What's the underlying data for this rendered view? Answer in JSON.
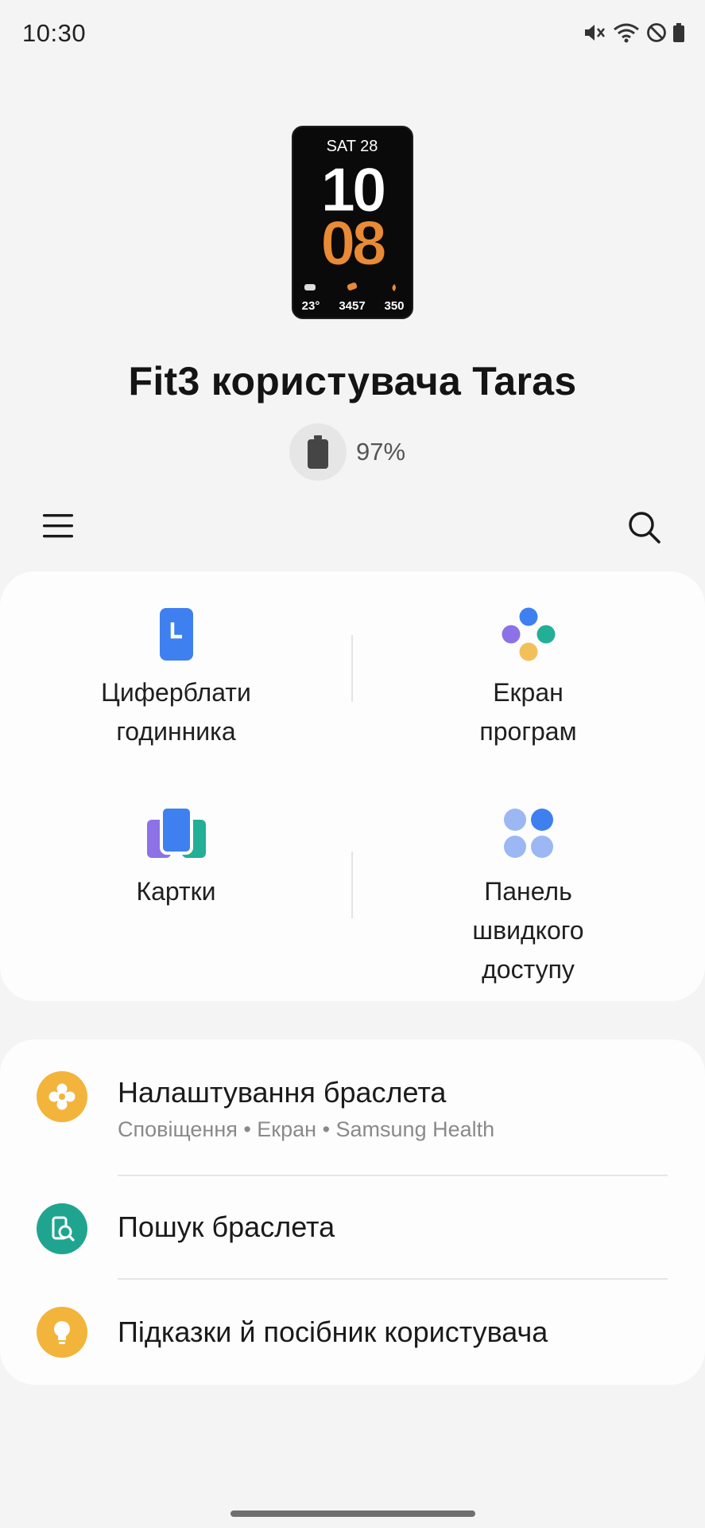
{
  "status_bar": {
    "time": "10:30"
  },
  "watch_face": {
    "date": "SAT 28",
    "hour": "10",
    "minute": "08",
    "temperature": "23°",
    "steps": "3457",
    "calories": "350"
  },
  "device": {
    "title": "Fit3 користувача Taras",
    "battery": "97%"
  },
  "toolbar": {
    "menu_icon": "hamburger-menu-icon",
    "search_icon": "search-icon"
  },
  "grid": [
    {
      "label": "Циферблати\nгодинника",
      "icon": "watch-face-icon"
    },
    {
      "label": "Екран\nпрограм",
      "icon": "apps-screen-icon"
    },
    {
      "label": "Картки",
      "icon": "tiles-icon"
    },
    {
      "label": "Панель\nшвидкого\nдоступу",
      "icon": "quick-panel-icon"
    }
  ],
  "list": [
    {
      "title": "Налаштування браслета",
      "subtitle": "Сповіщення • Екран • Samsung Health",
      "icon": "settings-icon",
      "color": "#f2b43b"
    },
    {
      "title": "Пошук браслета",
      "icon": "find-device-icon",
      "color": "#1fa58f"
    },
    {
      "title": "Підказки й посібник користувача",
      "icon": "lightbulb-icon",
      "color": "#f2b43b"
    }
  ],
  "colors": {
    "accent_blue": "#3f80f0",
    "accent_purple": "#8c72e6",
    "accent_teal": "#23ae98",
    "accent_yellow": "#f2b43b",
    "watch_orange": "#e98a35"
  }
}
